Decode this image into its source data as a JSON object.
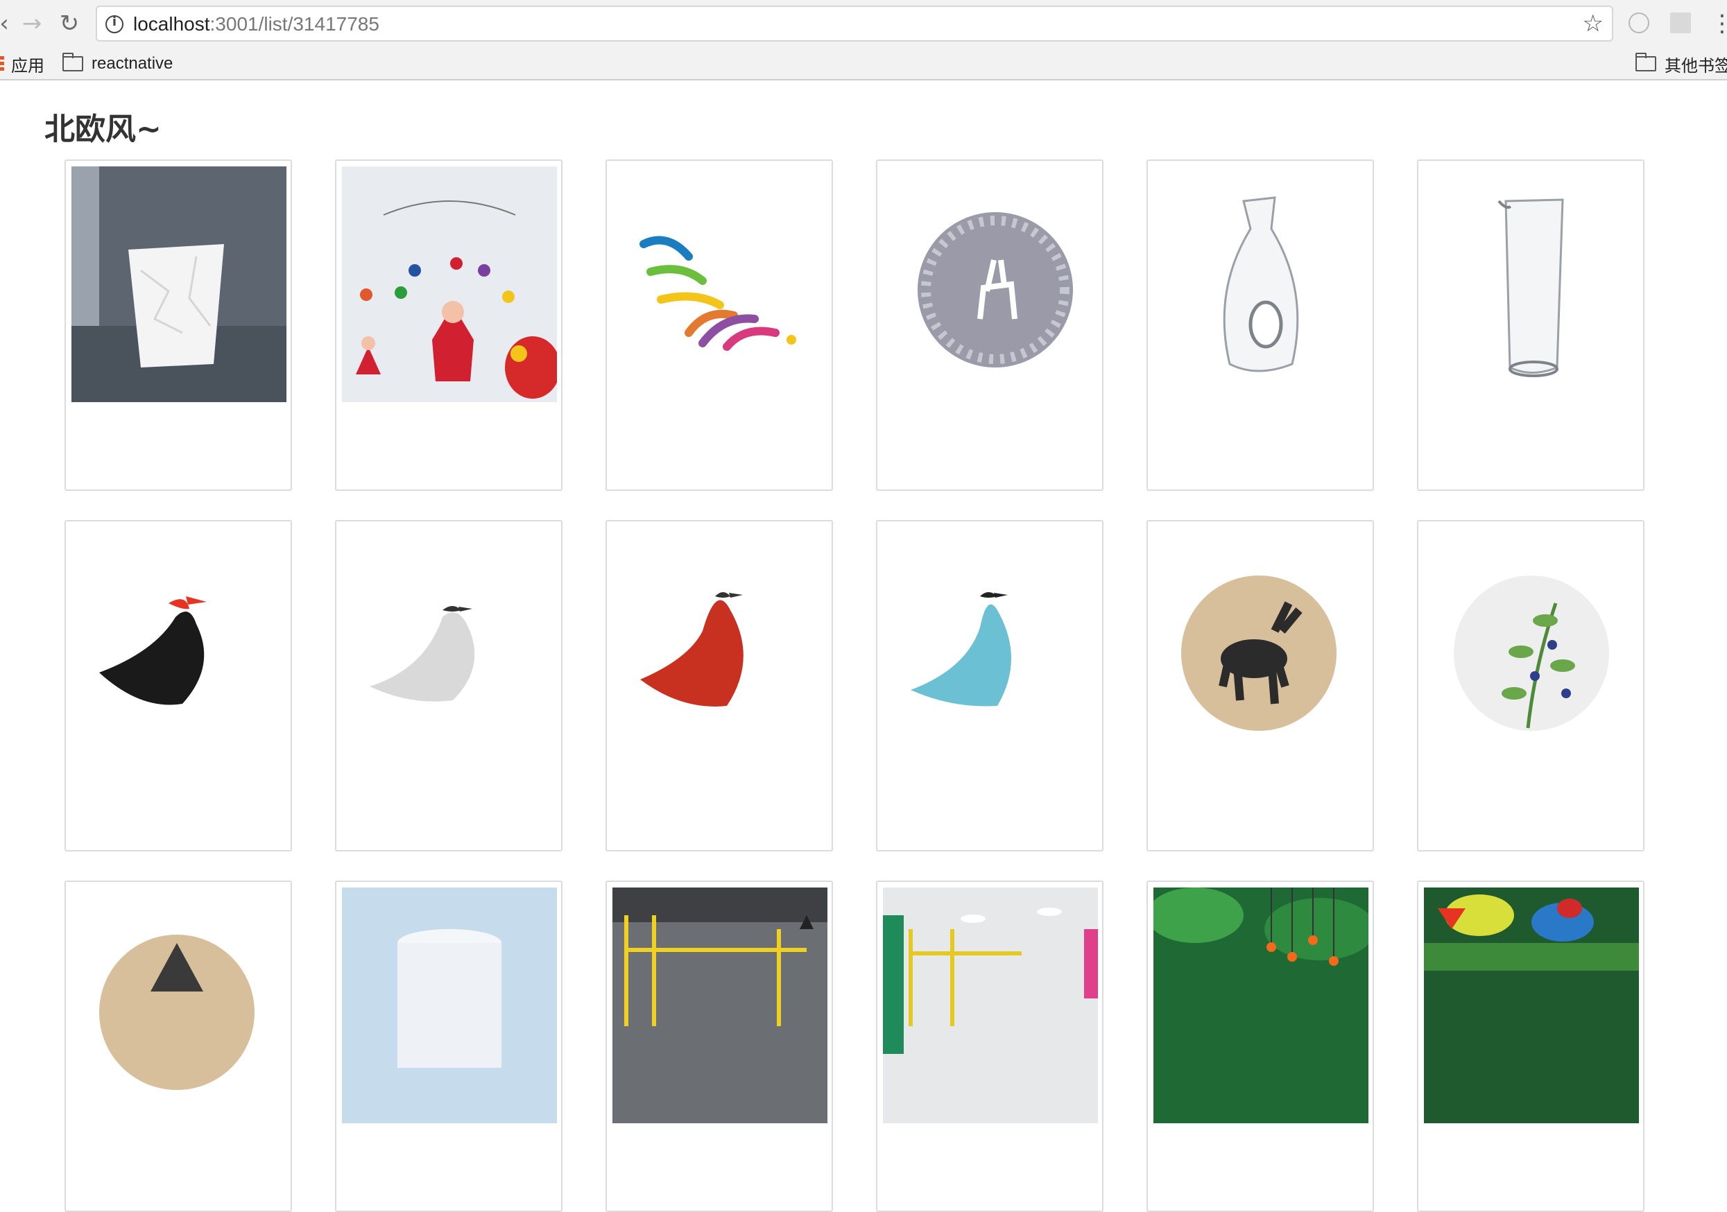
{
  "browser": {
    "url_host": "localhost",
    "url_path": ":3001/list/31417785",
    "bookmarks": [
      {
        "label": "应用"
      },
      {
        "label": "reactnative"
      },
      {
        "label": "其他书签"
      }
    ]
  },
  "page": {
    "title": "北欧风~"
  },
  "products": [
    {
      "icon": "crumpled-paper-bin-image"
    },
    {
      "icon": "clown-mobile-image"
    },
    {
      "icon": "rainbow-mobile-image"
    },
    {
      "icon": "deer-tray-image"
    },
    {
      "icon": "glass-carafe-image"
    },
    {
      "icon": "glass-pitcher-image"
    },
    {
      "icon": "black-glass-bird-image"
    },
    {
      "icon": "white-glass-bird-image"
    },
    {
      "icon": "red-glass-bird-image"
    },
    {
      "icon": "blue-glass-bird-image"
    },
    {
      "icon": "stag-tray-image"
    },
    {
      "icon": "blueberry-tray-image"
    },
    {
      "icon": "wood-tray-image"
    },
    {
      "icon": "white-stool-image"
    },
    {
      "icon": "yellow-scaffold-room-image"
    },
    {
      "icon": "office-interior-image"
    },
    {
      "icon": "green-lamp-room-image"
    },
    {
      "icon": "colorful-lamp-room-image"
    }
  ],
  "colors": {
    "bookmark_bar": "#f2f2f2",
    "card_border": "#dcdcdc",
    "title_text": "#333333"
  }
}
